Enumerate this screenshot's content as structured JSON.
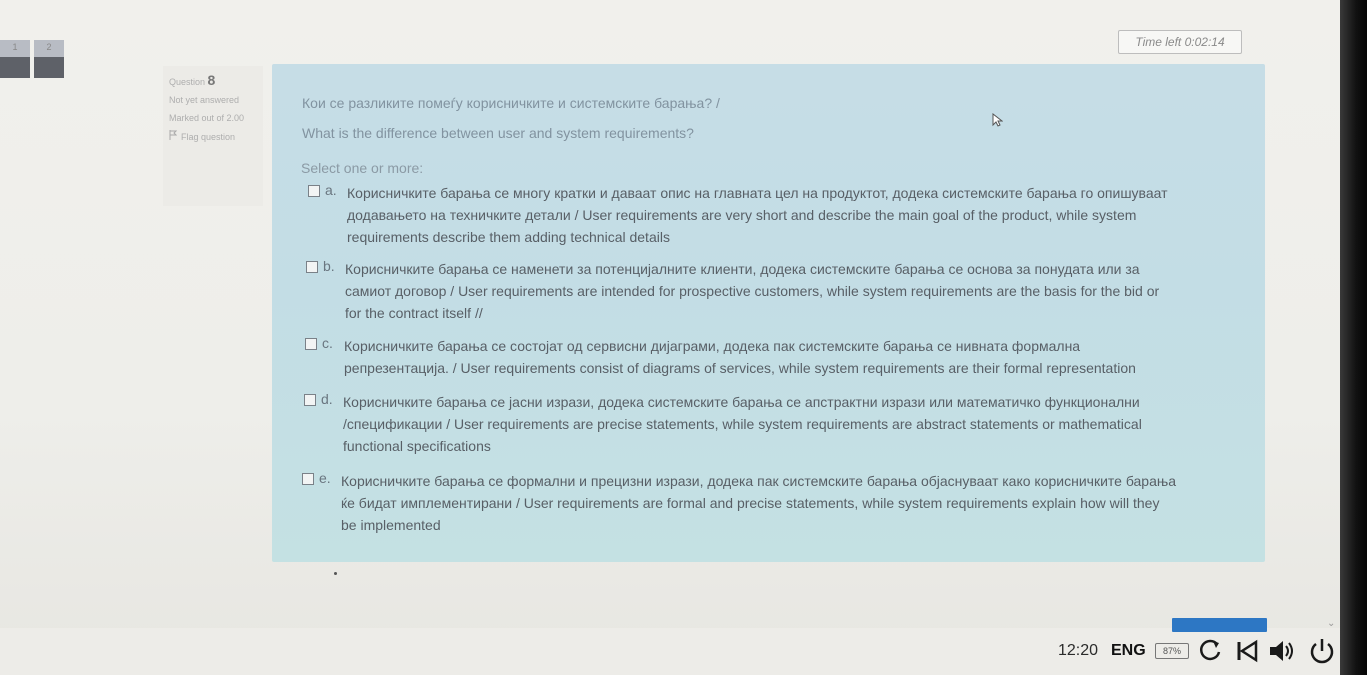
{
  "nav": {
    "tiles": [
      {
        "label": "1"
      },
      {
        "label": "2"
      }
    ]
  },
  "timer": {
    "text": "Time left 0:02:14"
  },
  "question_info": {
    "prefix": "Question",
    "number": "8",
    "status": "Not yet answered",
    "marks": "Marked out of 2.00",
    "flag_label": "Flag question"
  },
  "question": {
    "text_mk": "Кои се разликите помеѓу корисничките и системските барања? /",
    "text_en": "What is the difference between user and system requirements?",
    "select_prompt": "Select one or more:",
    "options": [
      {
        "letter": "a.",
        "lines": [
          "Корисничките барања се многу кратки и даваат опис на главната цел на продуктот, додека системските барања го опишуваат",
          "додавањето на техничките детали / User requirements are very short and describe the main goal of the product, while system",
          "requirements describe them adding technical details"
        ]
      },
      {
        "letter": "b.",
        "lines": [
          "Корисничките барања се наменети за потенцијалните клиенти, додека системските барања се основа за понудата или за",
          "самиот договор / User requirements are intended for prospective customers, while system requirements are the basis for the bid or",
          "for the contract itself //"
        ]
      },
      {
        "letter": "c.",
        "lines": [
          "Корисничките барања се состојат од сервисни дијаграми, додека пак системските барања се нивната формална",
          "репрезентација. / User requirements consist of diagrams of services, while system requirements are their formal representation"
        ]
      },
      {
        "letter": "d.",
        "lines": [
          "Корисничките барања се јасни изрази, додека системските барања се апстрактни изрази или математичко функционални",
          "/спецификации / User requirements are precise statements, while system requirements are abstract statements or mathematical",
          "functional specifications"
        ]
      },
      {
        "letter": "e.",
        "lines": [
          "Корисничките барања се формални и прецизни изрази, додека пак системските барања објаснуваат како корисничките барања",
          "ќе бидат имплементирани / User requirements are formal and precise statements, while system requirements explain how will they",
          "be implemented"
        ]
      }
    ]
  },
  "taskbar": {
    "clock": "12:20",
    "language": "ENG",
    "battery": "87%"
  },
  "colors": {
    "accent": "#2d77c4",
    "question_bg": "#c5dee5"
  },
  "icons": [
    "refresh-icon",
    "back-icon",
    "volume-icon",
    "power-icon",
    "cursor-icon",
    "flag-icon"
  ]
}
